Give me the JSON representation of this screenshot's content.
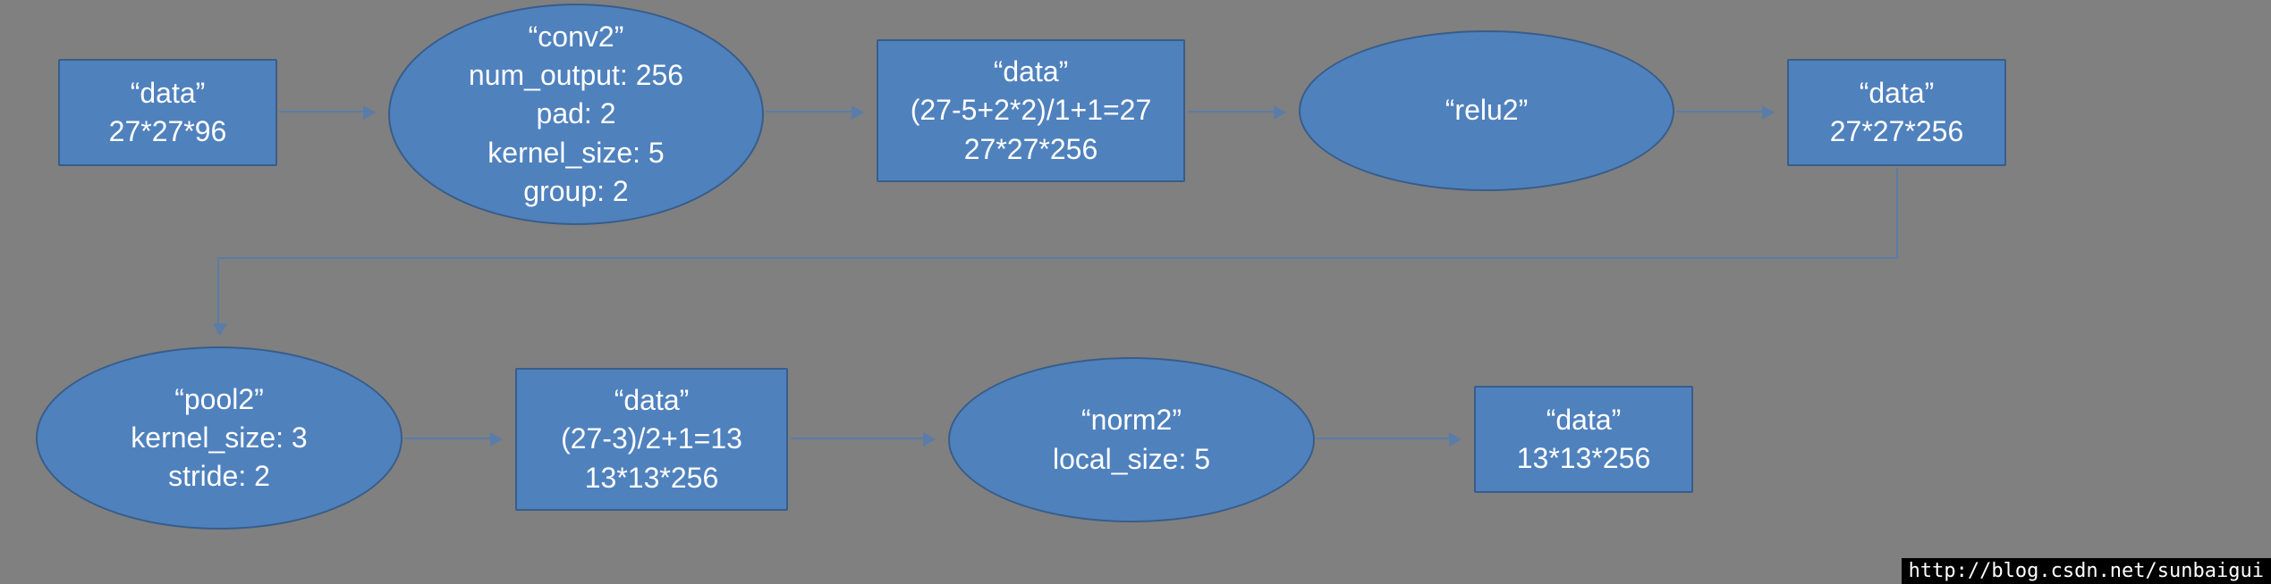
{
  "nodes": {
    "n1": {
      "lines": [
        "“data”",
        "27*27*96"
      ]
    },
    "n2": {
      "lines": [
        "“conv2”",
        "num_output: 256",
        "pad: 2",
        "kernel_size: 5",
        "group: 2"
      ]
    },
    "n3": {
      "lines": [
        "“data”",
        "(27-5+2*2)/1+1=27",
        "27*27*256"
      ]
    },
    "n4": {
      "lines": [
        "“relu2”"
      ]
    },
    "n5": {
      "lines": [
        "“data”",
        "27*27*256"
      ]
    },
    "n6": {
      "lines": [
        "“pool2”",
        "kernel_size: 3",
        "stride: 2"
      ]
    },
    "n7": {
      "lines": [
        "“data”",
        "(27-3)/2+1=13",
        "13*13*256"
      ]
    },
    "n8": {
      "lines": [
        "“norm2”",
        "local_size: 5"
      ]
    },
    "n9": {
      "lines": [
        "“data”",
        "13*13*256"
      ]
    }
  },
  "watermark": "http://blog.csdn.net/sunbaigui",
  "chart_data": {
    "type": "diagram",
    "title": "AlexNet conv2 block flow",
    "nodes": [
      {
        "id": "n1",
        "shape": "rect",
        "label": "data",
        "detail": "27*27*96"
      },
      {
        "id": "n2",
        "shape": "ellipse",
        "label": "conv2",
        "params": {
          "num_output": 256,
          "pad": 2,
          "kernel_size": 5,
          "group": 2
        }
      },
      {
        "id": "n3",
        "shape": "rect",
        "label": "data",
        "detail": "(27-5+2*2)/1+1=27 27*27*256"
      },
      {
        "id": "n4",
        "shape": "ellipse",
        "label": "relu2"
      },
      {
        "id": "n5",
        "shape": "rect",
        "label": "data",
        "detail": "27*27*256"
      },
      {
        "id": "n6",
        "shape": "ellipse",
        "label": "pool2",
        "params": {
          "kernel_size": 3,
          "stride": 2
        }
      },
      {
        "id": "n7",
        "shape": "rect",
        "label": "data",
        "detail": "(27-3)/2+1=13 13*13*256"
      },
      {
        "id": "n8",
        "shape": "ellipse",
        "label": "norm2",
        "params": {
          "local_size": 5
        }
      },
      {
        "id": "n9",
        "shape": "rect",
        "label": "data",
        "detail": "13*13*256"
      }
    ],
    "edges": [
      [
        "n1",
        "n2"
      ],
      [
        "n2",
        "n3"
      ],
      [
        "n3",
        "n4"
      ],
      [
        "n4",
        "n5"
      ],
      [
        "n5",
        "n6"
      ],
      [
        "n6",
        "n7"
      ],
      [
        "n7",
        "n8"
      ],
      [
        "n8",
        "n9"
      ]
    ]
  }
}
